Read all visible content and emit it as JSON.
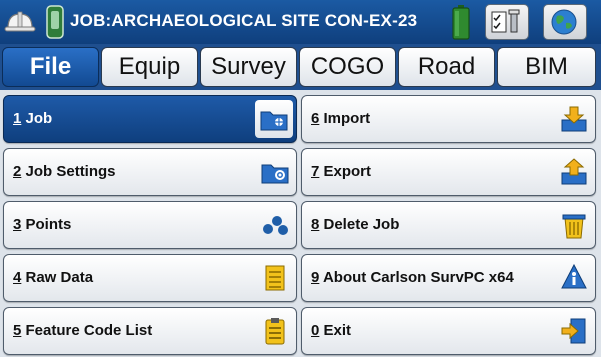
{
  "header": {
    "job_title": "JOB:ARCHAEOLOGICAL SITE CON-EX-23"
  },
  "tabs": [
    {
      "label": "File",
      "active": true
    },
    {
      "label": "Equip",
      "active": false
    },
    {
      "label": "Survey",
      "active": false
    },
    {
      "label": "COGO",
      "active": false
    },
    {
      "label": "Road",
      "active": false
    },
    {
      "label": "BIM",
      "active": false
    }
  ],
  "menu": {
    "left": [
      {
        "num": "1",
        "label": " Job",
        "icon": "folder-icon",
        "selected": true
      },
      {
        "num": "2",
        "label": " Job Settings",
        "icon": "folder-settings-icon",
        "selected": false
      },
      {
        "num": "3",
        "label": " Points",
        "icon": "points-icon",
        "selected": false
      },
      {
        "num": "4",
        "label": " Raw Data",
        "icon": "raw-data-icon",
        "selected": false
      },
      {
        "num": "5",
        "label": " Feature Code List",
        "icon": "clipboard-icon",
        "selected": false
      }
    ],
    "right": [
      {
        "num": "6",
        "label": " Import",
        "icon": "import-icon",
        "selected": false
      },
      {
        "num": "7",
        "label": " Export",
        "icon": "export-icon",
        "selected": false
      },
      {
        "num": "8",
        "label": " Delete Job",
        "icon": "delete-job-icon",
        "selected": false
      },
      {
        "num": "9",
        "label": " About Carlson SurvPC x64",
        "icon": "info-icon",
        "selected": false
      },
      {
        "num": "0",
        "label": " Exit",
        "icon": "exit-icon",
        "selected": false
      }
    ]
  },
  "colors": {
    "title_bar": "#1b5aa3",
    "selected_button": "#1e5aa8",
    "battery_green": "#2f8a2f"
  }
}
